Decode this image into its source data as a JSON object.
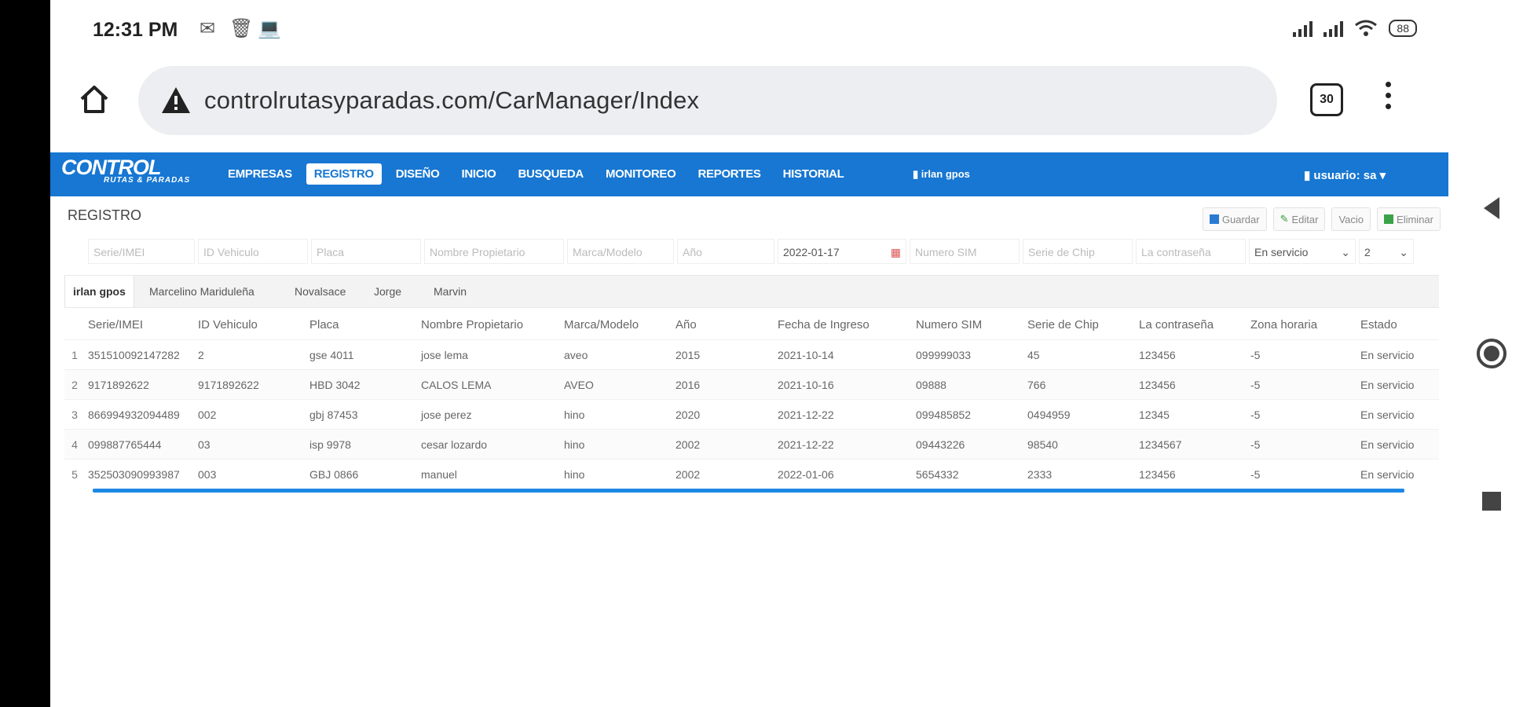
{
  "status_bar": {
    "time": "12:31 PM",
    "left_icons": [
      "mail-icon",
      "trash-icon",
      "laptop-icon"
    ],
    "battery": "88"
  },
  "browser": {
    "url": "controlrutasyparadas.com/CarManager/Index",
    "tabs_count": "30"
  },
  "app": {
    "logo_main": "CONTROL",
    "logo_sub": "RUTAS & PARADAS",
    "menu": [
      "EMPRESAS",
      "REGISTRO",
      "DISEÑO",
      "INICIO",
      "BUSQUEDA",
      "MONITOREO",
      "REPORTES",
      "HISTORIAL"
    ],
    "active_menu": "REGISTRO",
    "user_mid": "irlan gpos",
    "user_right": "usuario: sa"
  },
  "page": {
    "title": "REGISTRO",
    "actions": [
      "Guardar",
      "Editar",
      "Vacio",
      "Eliminar"
    ]
  },
  "form": {
    "fields": [
      "Serie/IMEI",
      "ID Vehiculo",
      "Placa",
      "Nombre Propietario",
      "Marca/Modelo",
      "Año"
    ],
    "date_value": "2022-01-17",
    "fields2": [
      "Numero SIM",
      "Serie de Chip",
      "La contraseña"
    ],
    "estado_select": "En servicio",
    "zona_select": "2"
  },
  "tabs": [
    "irlan gpos",
    "Marcelino Mariduleña",
    "Novalsace",
    "Jorge",
    "Marvin"
  ],
  "table": {
    "headers": [
      "Serie/IMEI",
      "ID Vehiculo",
      "Placa",
      "Nombre Propietario",
      "Marca/Modelo",
      "Año",
      "Fecha de Ingreso",
      "Numero SIM",
      "Serie de Chip",
      "La contraseña",
      "Zona horaria",
      "Estado"
    ],
    "rows": [
      [
        "1",
        "351510092147282",
        "2",
        "gse 4011",
        "jose lema",
        "aveo",
        "2015",
        "2021-10-14",
        "099999033",
        "45",
        "123456",
        "-5",
        "En servicio"
      ],
      [
        "2",
        "9171892622",
        "9171892622",
        "HBD 3042",
        "CALOS LEMA",
        "AVEO",
        "2016",
        "2021-10-16",
        "09888",
        "766",
        "123456",
        "-5",
        "En servicio"
      ],
      [
        "3",
        "866994932094489",
        "002",
        "gbj 87453",
        "jose perez",
        "hino",
        "2020",
        "2021-12-22",
        "099485852",
        "0494959",
        "12345",
        "-5",
        "En servicio"
      ],
      [
        "4",
        "099887765444",
        "03",
        "isp 9978",
        "cesar lozardo",
        "hino",
        "2002",
        "2021-12-22",
        "09443226",
        "98540",
        "1234567",
        "-5",
        "En servicio"
      ],
      [
        "5",
        "352503090993987",
        "003",
        "GBJ 0866",
        "manuel",
        "hino",
        "2002",
        "2022-01-06",
        "5654332",
        "2333",
        "123456",
        "-5",
        "En servicio"
      ]
    ]
  }
}
